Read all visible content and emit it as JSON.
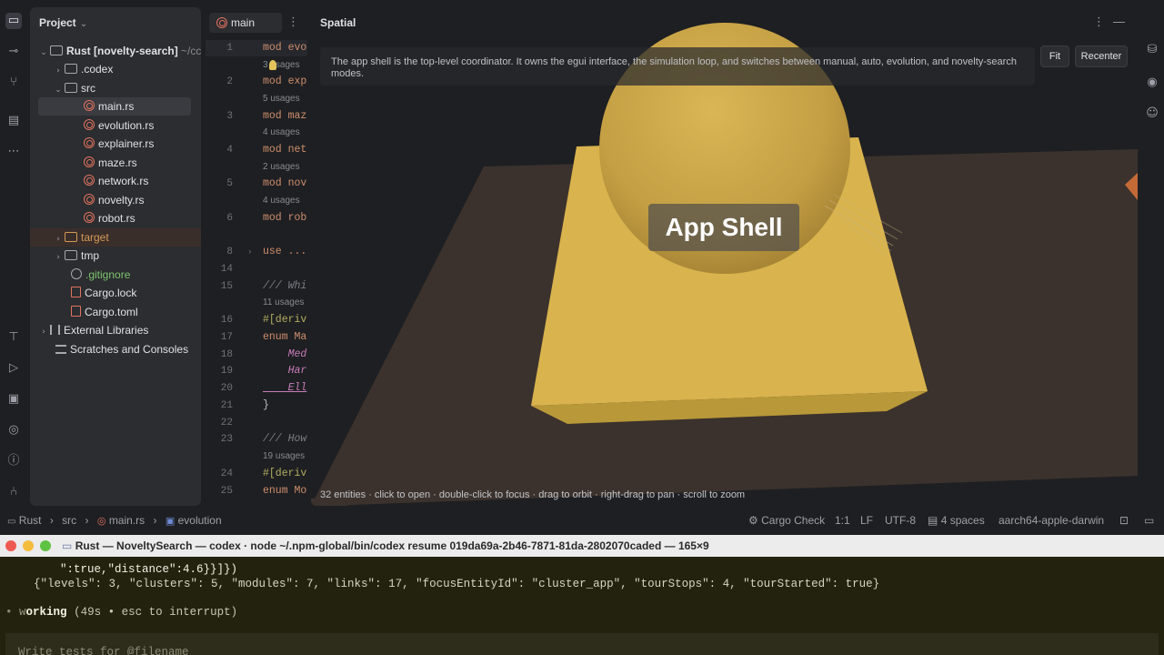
{
  "project": {
    "title": "Project",
    "root_name": "Rust [novelty-search]",
    "root_path": "~/cc",
    "items": [
      {
        "label": ".codex"
      },
      {
        "label": "src"
      },
      {
        "label": "main.rs"
      },
      {
        "label": "evolution.rs"
      },
      {
        "label": "explainer.rs"
      },
      {
        "label": "maze.rs"
      },
      {
        "label": "network.rs"
      },
      {
        "label": "novelty.rs"
      },
      {
        "label": "robot.rs"
      },
      {
        "label": "target"
      },
      {
        "label": "tmp"
      },
      {
        "label": ".gitignore"
      },
      {
        "label": "Cargo.lock"
      },
      {
        "label": "Cargo.toml"
      },
      {
        "label": "External Libraries"
      },
      {
        "label": "Scratches and Consoles"
      }
    ]
  },
  "editor": {
    "tab_label": "main",
    "lines": [
      {
        "n": "1",
        "code": "mod evo",
        "usage": "3 usages"
      },
      {
        "n": "2",
        "code": "mod exp",
        "usage": "5 usages"
      },
      {
        "n": "3",
        "code": "mod maz",
        "usage": "4 usages"
      },
      {
        "n": "4",
        "code": "mod net",
        "usage": "2 usages"
      },
      {
        "n": "5",
        "code": "mod nov",
        "usage": "4 usages"
      },
      {
        "n": "6",
        "code": "mod rob"
      },
      {
        "n": "8",
        "code": "use ..."
      },
      {
        "n": "14",
        "code": ""
      },
      {
        "n": "15",
        "code": "/// Whi",
        "usage": "11 usages"
      },
      {
        "n": "16",
        "code": "#[deriv"
      },
      {
        "n": "17",
        "code": "enum Ma"
      },
      {
        "n": "18",
        "code": "    Med"
      },
      {
        "n": "19",
        "code": "    Har"
      },
      {
        "n": "20",
        "code": "    Ell"
      },
      {
        "n": "21",
        "code": "}"
      },
      {
        "n": "22",
        "code": ""
      },
      {
        "n": "23",
        "code": "/// How",
        "usage": "19 usages"
      },
      {
        "n": "24",
        "code": "#[deriv"
      },
      {
        "n": "25",
        "code": "enum Mo"
      }
    ]
  },
  "spatial": {
    "title": "Spatial",
    "info": "The app shell is the top-level coordinator. It owns the egui interface, the simulation loop, and switches between manual, auto, evolution, and novelty-search modes.",
    "fit_label": "Fit",
    "recenter_label": "Recenter",
    "focus_label": "App Shell",
    "hint": "32 entities · click to open · double-click to focus · drag to orbit · right-drag to pan · scroll to zoom"
  },
  "statusbar": {
    "crumb_root": "Rust",
    "crumb_src": "src",
    "crumb_file": "main.rs",
    "crumb_symbol": "evolution",
    "cargo_check": "Cargo Check",
    "position": "1:1",
    "line_ending": "LF",
    "encoding": "UTF-8",
    "indent": "4 spaces",
    "target": "aarch64-apple-darwin"
  },
  "terminal": {
    "title_app": "Rust —",
    "title_rest": "NoveltySearch — codex · node ~/.npm-global/bin/codex resume 019da69a-2b46-7871-81da-2802070caded — 165×9",
    "line1": "\":true,\"distance\":4.6}}]})",
    "line2": "{\"levels\": 3, \"clusters\": 5, \"modules\": 7, \"links\": 17, \"focusEntityId\": \"cluster_app\", \"tourStops\": 4, \"tourStarted\": true}",
    "working_label": "orking",
    "working_detail": "(49s • esc to interrupt)",
    "prompt_placeholder": "Write tests for @filename"
  },
  "colors": {
    "accent_rust": "#e0735f",
    "folder_excluded": "#d39a54",
    "box_yellow": "#d9b34d",
    "floor_brown": "#3e3530"
  }
}
